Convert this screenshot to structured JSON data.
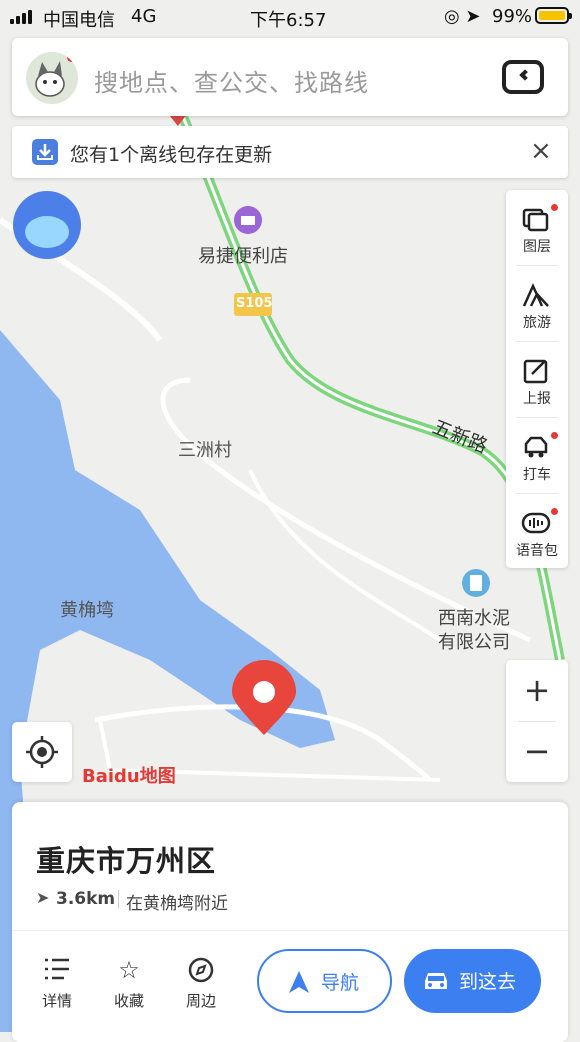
{
  "status_bar": {
    "carrier": "中国电信",
    "network": "4G",
    "time": "下午6:57",
    "battery_percent_text": "99%",
    "battery_level": 0.99
  },
  "search": {
    "placeholder": "搜地点、查公交、找路线",
    "avatar_icon": "cartoon-avatar",
    "right_icon": "car-mode-icon"
  },
  "notice": {
    "text": "您有1个离线包存在更新",
    "close_symbol": "×"
  },
  "map": {
    "labels": {
      "store": "易捷便利店",
      "route_badge": "S105",
      "village": "三洲村",
      "road": "五新路",
      "area": "黄桷塆",
      "company_line1": "西南水泥",
      "company_line2": "有限公司"
    },
    "logo_text": "Baidu地图",
    "colors": {
      "water": "#8fb8f0",
      "road_green": "#7dd67d",
      "land": "#efefed",
      "marker": "#e8453c"
    }
  },
  "toolbar": {
    "items": [
      {
        "label": "图层",
        "icon": "layers-icon"
      },
      {
        "label": "旅游",
        "icon": "travel-icon"
      },
      {
        "label": "上报",
        "icon": "report-icon"
      },
      {
        "label": "打车",
        "icon": "taxi-icon"
      },
      {
        "label": "语音包",
        "icon": "voice-pack-icon"
      }
    ]
  },
  "zoom": {
    "in_label": "+",
    "out_label": "−"
  },
  "card": {
    "title": "重庆市万州区",
    "distance": "3.6km",
    "near": "在黄桷塆附近",
    "actions": [
      {
        "label": "详情",
        "icon": "list-icon"
      },
      {
        "label": "收藏",
        "icon": "star-icon"
      },
      {
        "label": "周边",
        "icon": "compass-icon"
      }
    ],
    "navigate_label": "导航",
    "go_label": "到这去"
  },
  "accent_color": "#3b7ff0"
}
